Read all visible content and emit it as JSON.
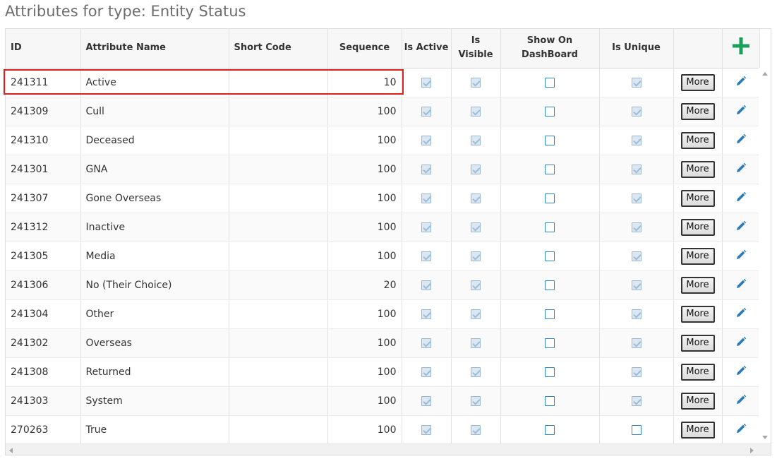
{
  "page": {
    "title": "Attributes for type: Entity Status"
  },
  "colors": {
    "accent_add": "#1aa05a",
    "edit_icon": "#2b7bb9",
    "highlight": "#d9201e",
    "checkbox_border": "#2f85c8"
  },
  "table": {
    "headers": {
      "id": "ID",
      "attribute_name": "Attribute Name",
      "short_code": "Short Code",
      "sequence": "Sequence",
      "is_active": "Is Active",
      "is_visible_l1": "Is",
      "is_visible_l2": "Visible",
      "show_on_dashboard_l1": "Show On",
      "show_on_dashboard_l2": "DashBoard",
      "is_unique": "Is Unique",
      "actions": "",
      "add_icon": "plus-icon"
    },
    "rows": [
      {
        "id": "241311",
        "name": "Active",
        "short_code": "",
        "sequence": "10",
        "is_active": true,
        "is_visible": true,
        "show_on_dashboard": false,
        "is_unique": true,
        "more_label": "More",
        "edit_icon": "pencil-icon"
      },
      {
        "id": "241309",
        "name": "Cull",
        "short_code": "",
        "sequence": "100",
        "is_active": true,
        "is_visible": true,
        "show_on_dashboard": false,
        "is_unique": true,
        "more_label": "More",
        "edit_icon": "pencil-icon"
      },
      {
        "id": "241310",
        "name": "Deceased",
        "short_code": "",
        "sequence": "100",
        "is_active": true,
        "is_visible": true,
        "show_on_dashboard": false,
        "is_unique": true,
        "more_label": "More",
        "edit_icon": "pencil-icon"
      },
      {
        "id": "241301",
        "name": "GNA",
        "short_code": "",
        "sequence": "100",
        "is_active": true,
        "is_visible": true,
        "show_on_dashboard": false,
        "is_unique": true,
        "more_label": "More",
        "edit_icon": "pencil-icon"
      },
      {
        "id": "241307",
        "name": "Gone Overseas",
        "short_code": "",
        "sequence": "100",
        "is_active": true,
        "is_visible": true,
        "show_on_dashboard": false,
        "is_unique": true,
        "more_label": "More",
        "edit_icon": "pencil-icon"
      },
      {
        "id": "241312",
        "name": "Inactive",
        "short_code": "",
        "sequence": "100",
        "is_active": true,
        "is_visible": true,
        "show_on_dashboard": false,
        "is_unique": true,
        "more_label": "More",
        "edit_icon": "pencil-icon"
      },
      {
        "id": "241305",
        "name": "Media",
        "short_code": "",
        "sequence": "100",
        "is_active": true,
        "is_visible": true,
        "show_on_dashboard": false,
        "is_unique": true,
        "more_label": "More",
        "edit_icon": "pencil-icon"
      },
      {
        "id": "241306",
        "name": "No (Their Choice)",
        "short_code": "",
        "sequence": "20",
        "is_active": true,
        "is_visible": true,
        "show_on_dashboard": false,
        "is_unique": true,
        "more_label": "More",
        "edit_icon": "pencil-icon"
      },
      {
        "id": "241304",
        "name": "Other",
        "short_code": "",
        "sequence": "100",
        "is_active": true,
        "is_visible": true,
        "show_on_dashboard": false,
        "is_unique": true,
        "more_label": "More",
        "edit_icon": "pencil-icon"
      },
      {
        "id": "241302",
        "name": "Overseas",
        "short_code": "",
        "sequence": "100",
        "is_active": true,
        "is_visible": true,
        "show_on_dashboard": false,
        "is_unique": true,
        "more_label": "More",
        "edit_icon": "pencil-icon"
      },
      {
        "id": "241308",
        "name": "Returned",
        "short_code": "",
        "sequence": "100",
        "is_active": true,
        "is_visible": true,
        "show_on_dashboard": false,
        "is_unique": true,
        "more_label": "More",
        "edit_icon": "pencil-icon"
      },
      {
        "id": "241303",
        "name": "System",
        "short_code": "",
        "sequence": "100",
        "is_active": true,
        "is_visible": true,
        "show_on_dashboard": false,
        "is_unique": true,
        "more_label": "More",
        "edit_icon": "pencil-icon"
      },
      {
        "id": "270263",
        "name": "True",
        "short_code": "",
        "sequence": "100",
        "is_active": true,
        "is_visible": true,
        "show_on_dashboard": false,
        "is_unique": false,
        "more_label": "More",
        "edit_icon": "pencil-icon"
      }
    ]
  }
}
